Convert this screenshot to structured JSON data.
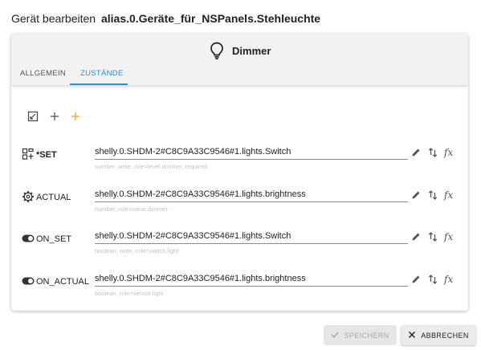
{
  "dialog": {
    "title_prefix": "Gerät bearbeiten",
    "title_path": "alias.0.Geräte_für_NSPanels.Stehleuchte"
  },
  "device": {
    "name": "Dimmer",
    "icon": "lightbulb-icon"
  },
  "tabs": [
    {
      "label": "ALLGEMEIN",
      "active": false
    },
    {
      "label": "ZUSTÄNDE",
      "active": true
    }
  ],
  "toolbar": {
    "icons": [
      "edit-square-icon",
      "plus-icon",
      "plus-icon-orange"
    ],
    "accent": "#f0a030"
  },
  "states": [
    {
      "name": "*SET",
      "icon": "dashboard-icon",
      "value": "shelly.0.SHDM-2#C8C9A33C9546#1.lights.Switch",
      "hint": "number, write, role=level.dimmer, required"
    },
    {
      "name": "ACTUAL",
      "icon": "gear-icon",
      "value": "shelly.0.SHDM-2#C8C9A33C9546#1.lights.brightness",
      "hint": "number, role=value.dimmer"
    },
    {
      "name": "ON_SET",
      "icon": "toggle-icon",
      "value": "shelly.0.SHDM-2#C8C9A33C9546#1.lights.Switch",
      "hint": "boolean, write, role=switch.light"
    },
    {
      "name": "ON_ACTUAL",
      "icon": "toggle-icon",
      "value": "shelly.0.SHDM-2#C8C9A33C9546#1.lights.brightness",
      "hint": "boolean, role=sensor.light"
    }
  ],
  "row_actions": {
    "edit": "pencil-icon",
    "swap": "swap-vertical-icon",
    "function": "fx"
  },
  "buttons": {
    "save_label": "SPEICHERN",
    "save_enabled": false,
    "cancel_label": "ABBRECHEN"
  },
  "colors": {
    "accent_blue": "#2a90c9",
    "header_bg": "#f2f2f2"
  }
}
